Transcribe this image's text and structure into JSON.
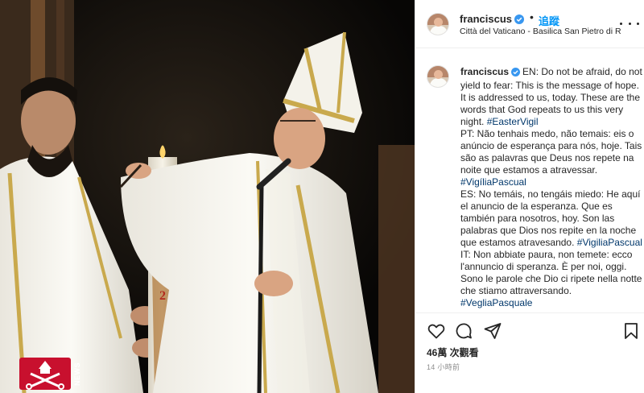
{
  "post": {
    "username": "franciscus",
    "follow_label": "追蹤",
    "separator": "•",
    "location": "Città del Vaticano - Basilica San Pietro di R...",
    "caption": {
      "username": "franciscus",
      "lines": [
        {
          "text": "EN: Do not be afraid, do not yield to fear: This is the message of hope. It is addressed to us, today. These are the words that God repeats to us this very night. ",
          "tag": "#EasterVigil"
        },
        {
          "text": "PT: Não tenhais medo, não temais: eis o anúncio de esperança para nós, hoje. Tais são as palavras que Deus nos repete na noite que estamos a atravessar. ",
          "tag": "#VigíliaPascual"
        },
        {
          "text": "ES: No temáis, no tengáis miedo: He aquí el anuncio de la esperanza. Que es también para nosotros, hoy. Son las palabras que Dios nos repite en la noche que estamos atravesando. ",
          "tag": "#VigiliaPascual"
        },
        {
          "text": "IT: Non abbiate paura, non temete: ecco l'annuncio di speranza. È per noi, oggi. Sono le parole che Dio ci ripete nella notte che stiamo attraversando. ",
          "tag": "#VegliaPasquale"
        }
      ]
    },
    "views": "46萬 次觀看",
    "timestamp": "14 小時前"
  },
  "media": {
    "watermark": "NEWS",
    "candle_number": "2020"
  },
  "icons": {
    "like": "heart-icon",
    "comment": "comment-icon",
    "share": "share-icon",
    "save": "bookmark-icon",
    "more": "more-options-icon",
    "verified": "verified-badge-icon"
  },
  "colors": {
    "accent": "#0095f6",
    "verified": "#3897f0",
    "hashtag": "#00376b",
    "muted": "#8e8e8e",
    "news_logo": "#c8102e"
  }
}
